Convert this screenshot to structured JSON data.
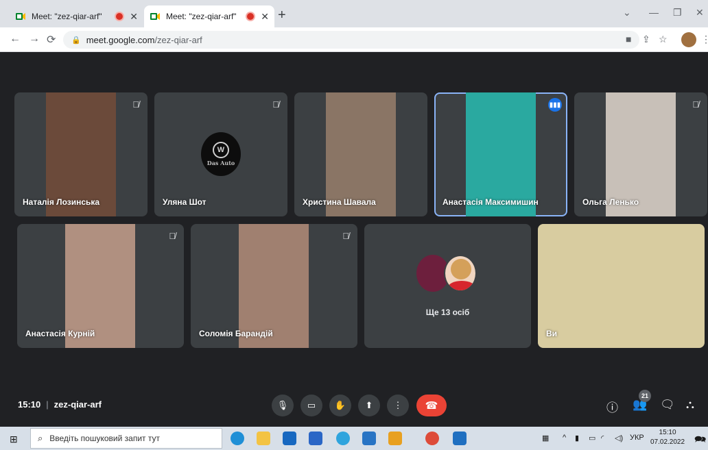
{
  "browser": {
    "tabs": [
      {
        "title": "Meet: \"zez-qiar-arf\"",
        "active": false
      },
      {
        "title": "Meet: \"zez-qiar-arf\"",
        "active": true
      }
    ],
    "new_tab_icon": "+",
    "url_host": "meet.google.com",
    "url_path": "/zez-qiar-arf"
  },
  "tiles": [
    {
      "name": "Наталія Лозинська",
      "muted": true,
      "kind": "video",
      "bg": "#6b4a3a"
    },
    {
      "name": "Уляна Шот",
      "muted": true,
      "kind": "logo",
      "logo_text": "Das Auto"
    },
    {
      "name": "Христина Шавала",
      "muted": false,
      "kind": "video",
      "bg": "#8a7565"
    },
    {
      "name": "Анастасія Максимишин",
      "muted": false,
      "speaking": true,
      "kind": "video",
      "bg": "#2aa9a0"
    },
    {
      "name": "Ольга Ленько",
      "muted": true,
      "kind": "video",
      "bg": "#c8c0b8"
    },
    {
      "name": "Анастасія Курній",
      "muted": true,
      "kind": "video",
      "bg": "#b09080"
    },
    {
      "name": "Соломія Барандій",
      "muted": true,
      "kind": "video",
      "bg": "#a08070"
    },
    {
      "name": "",
      "kind": "more",
      "label": "Ще 13 осіб"
    },
    {
      "name": "Ви",
      "muted": false,
      "kind": "video",
      "bg": "#d8cca0"
    }
  ],
  "bottom_bar": {
    "time": "15:10",
    "meeting_code": "zez-qiar-arf",
    "participants_count": "21"
  },
  "taskbar": {
    "search_placeholder": "Введіть пошуковий запит тут",
    "language": "УКР",
    "time": "15:10",
    "date": "07.02.2022"
  },
  "colors": {
    "meet_bg": "#202124",
    "tile_bg": "#3c4043",
    "speaking_outline": "#8ab4f8",
    "end_call": "#ea4335"
  }
}
